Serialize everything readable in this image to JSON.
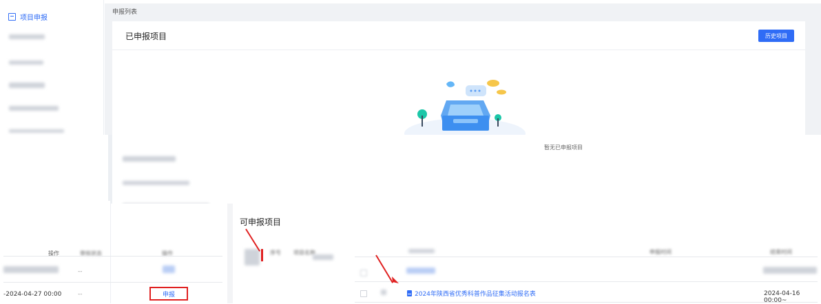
{
  "sidebar": {
    "active_item": "项目申报"
  },
  "breadcrumb": "申报列表",
  "card": {
    "title": "已申报项目",
    "history_button": "历史项目",
    "empty_text": "暂无已申报项目"
  },
  "available": {
    "title": "可申报项目",
    "header_left": {
      "operation": "操作",
      "status": "审核状态",
      "action": "操作"
    },
    "header_mid": {
      "index": "序号",
      "name": "项目名称"
    },
    "header_right": {
      "apply_time": "申报时间",
      "end_time": "结束时间"
    },
    "row": {
      "start_date": "-2024-04-27 00:00",
      "dash": "--",
      "apply_label": "申报",
      "project_name": "2024年陕西省优秀科普作品征集活动报名表",
      "end_date": "2024-04-16 00:00~"
    }
  },
  "colors": {
    "primary": "#2f6cf6",
    "annotation": "#e02020"
  }
}
